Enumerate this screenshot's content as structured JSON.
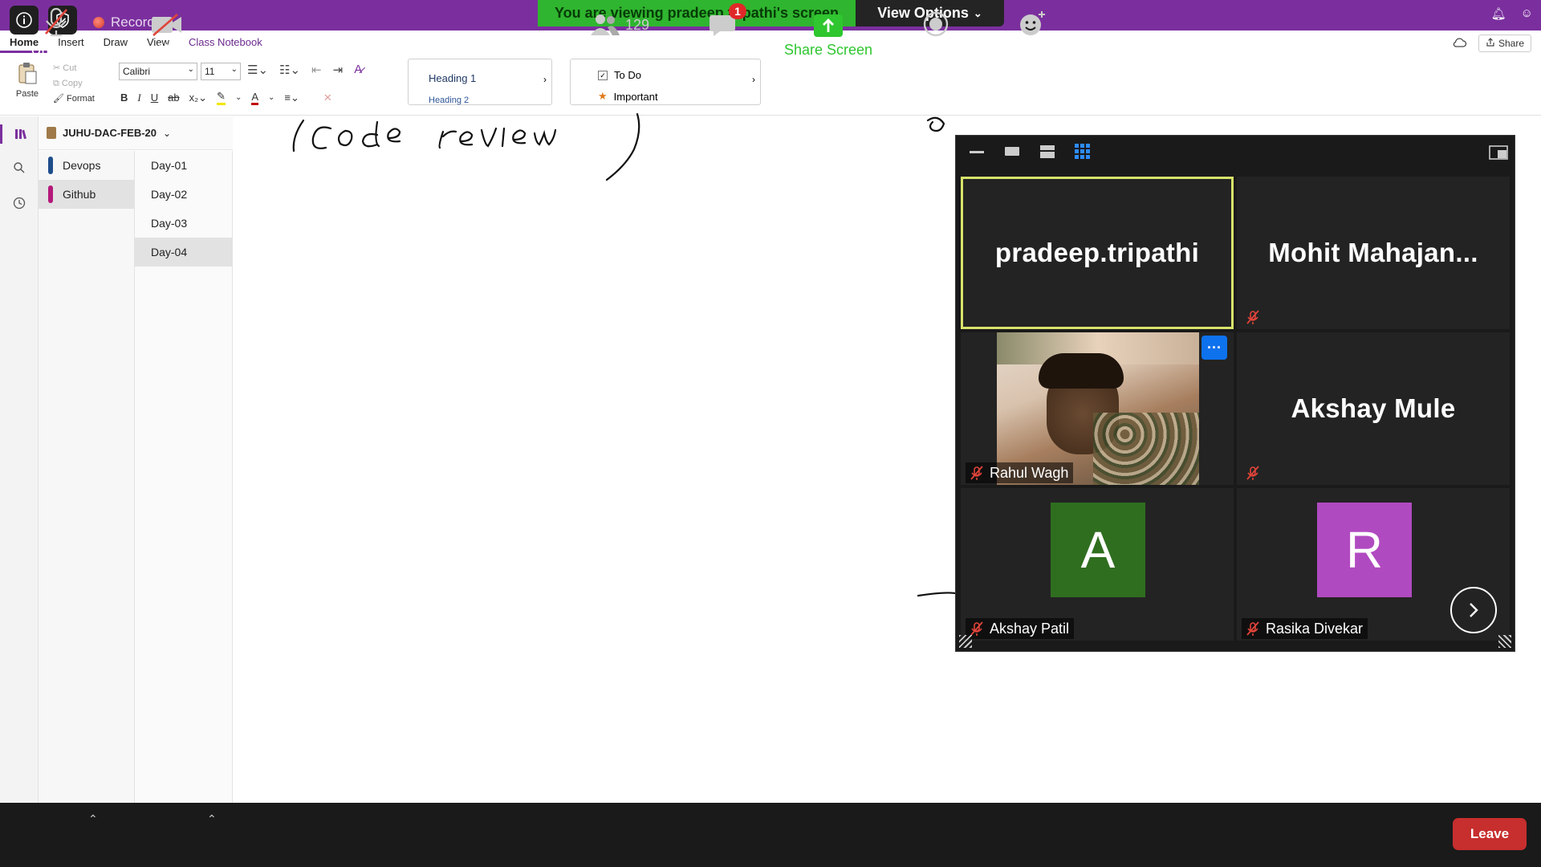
{
  "zoom": {
    "recording_label": "Recording",
    "viewing_banner": "You are viewing pradeep.tripathi's screen",
    "view_options_label": "View Options"
  },
  "onenote": {
    "tabs": [
      "Home",
      "Insert",
      "Draw",
      "View",
      "Class Notebook"
    ],
    "share_label": "Share",
    "clipboard": {
      "paste": "Paste",
      "cut": "Cut",
      "copy": "Copy",
      "format": "Format"
    },
    "font": {
      "name": "Calibri",
      "size": "11"
    },
    "styles": {
      "heading1": "Heading 1",
      "heading2": "Heading 2"
    },
    "tags": {
      "todo": "To Do",
      "important": "Important"
    },
    "notebook_name": "JUHU-DAC-FEB-20",
    "sections": [
      "Devops",
      "Github"
    ],
    "pages": [
      "Day-01",
      "Day-02",
      "Day-03",
      "Day-04"
    ],
    "colors": {
      "accent": "#7b2f9e",
      "devops_tab": "#1f4e8c",
      "github_tab": "#b4197a"
    }
  },
  "participants": {
    "tile1": {
      "name": "pradeep.tripathi"
    },
    "tile2": {
      "name": "Mohit  Mahajan..."
    },
    "tile3": {
      "name": "Rahul Wagh"
    },
    "tile4": {
      "name": "Akshay Mule"
    },
    "tile5": {
      "name": "Akshay Patil",
      "initial": "A",
      "color": "#2f6e1f"
    },
    "tile6": {
      "name": "Rasika Divekar",
      "initial": "R",
      "color": "#b04ac0"
    }
  },
  "toolbar": {
    "unmute": "Unmute",
    "start_video": "Start Video",
    "participants": "Participants",
    "participant_count": "129",
    "chat": "Chat",
    "chat_badge": "1",
    "share_screen": "Share Screen",
    "record": "Record",
    "reactions": "Reactions",
    "leave": "Leave"
  }
}
